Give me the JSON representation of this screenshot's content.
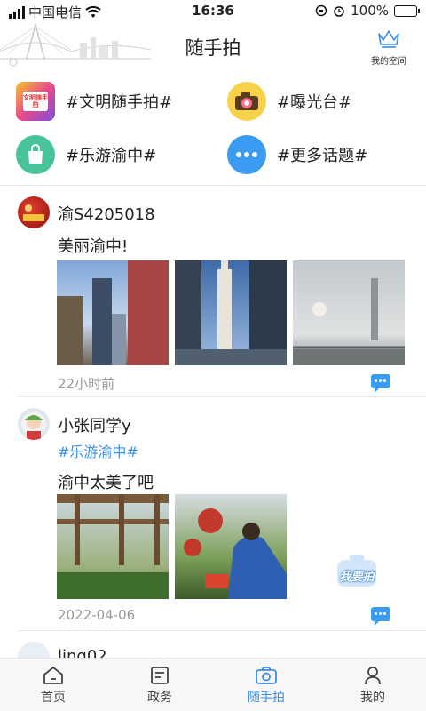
{
  "status_bar": {
    "carrier": "中国电信",
    "time": "16:36",
    "battery": "100%"
  },
  "header": {
    "title": "随手拍",
    "my_space": "我的空间"
  },
  "topics": [
    {
      "label": "#文明随手拍#",
      "icon": "civilization-photo-icon",
      "badge": "文明随手拍"
    },
    {
      "label": "#曝光台#",
      "icon": "camera-icon"
    },
    {
      "label": "#乐游渝中#",
      "icon": "shopping-bag-icon"
    },
    {
      "label": "#更多话题#",
      "icon": "more-dots-icon"
    }
  ],
  "posts": [
    {
      "user": "渝S4205018",
      "text": "美丽渝中!",
      "time": "22小时前"
    },
    {
      "user": "小张同学y",
      "tag": "#乐游渝中#",
      "text": "渝中太美了吧",
      "time": "2022-04-06"
    },
    {
      "user": "ling02"
    }
  ],
  "fab": {
    "label": "我要拍"
  },
  "tabs": [
    {
      "label": "首页",
      "icon": "home-icon"
    },
    {
      "label": "政务",
      "icon": "document-icon"
    },
    {
      "label": "随手拍",
      "icon": "camera-icon"
    },
    {
      "label": "我的",
      "icon": "user-icon"
    }
  ],
  "active_tab": "随手拍",
  "colors": {
    "accent": "#3a8ee6",
    "comment_icon": "#3a9bf0",
    "battery": "#2fcb45"
  }
}
